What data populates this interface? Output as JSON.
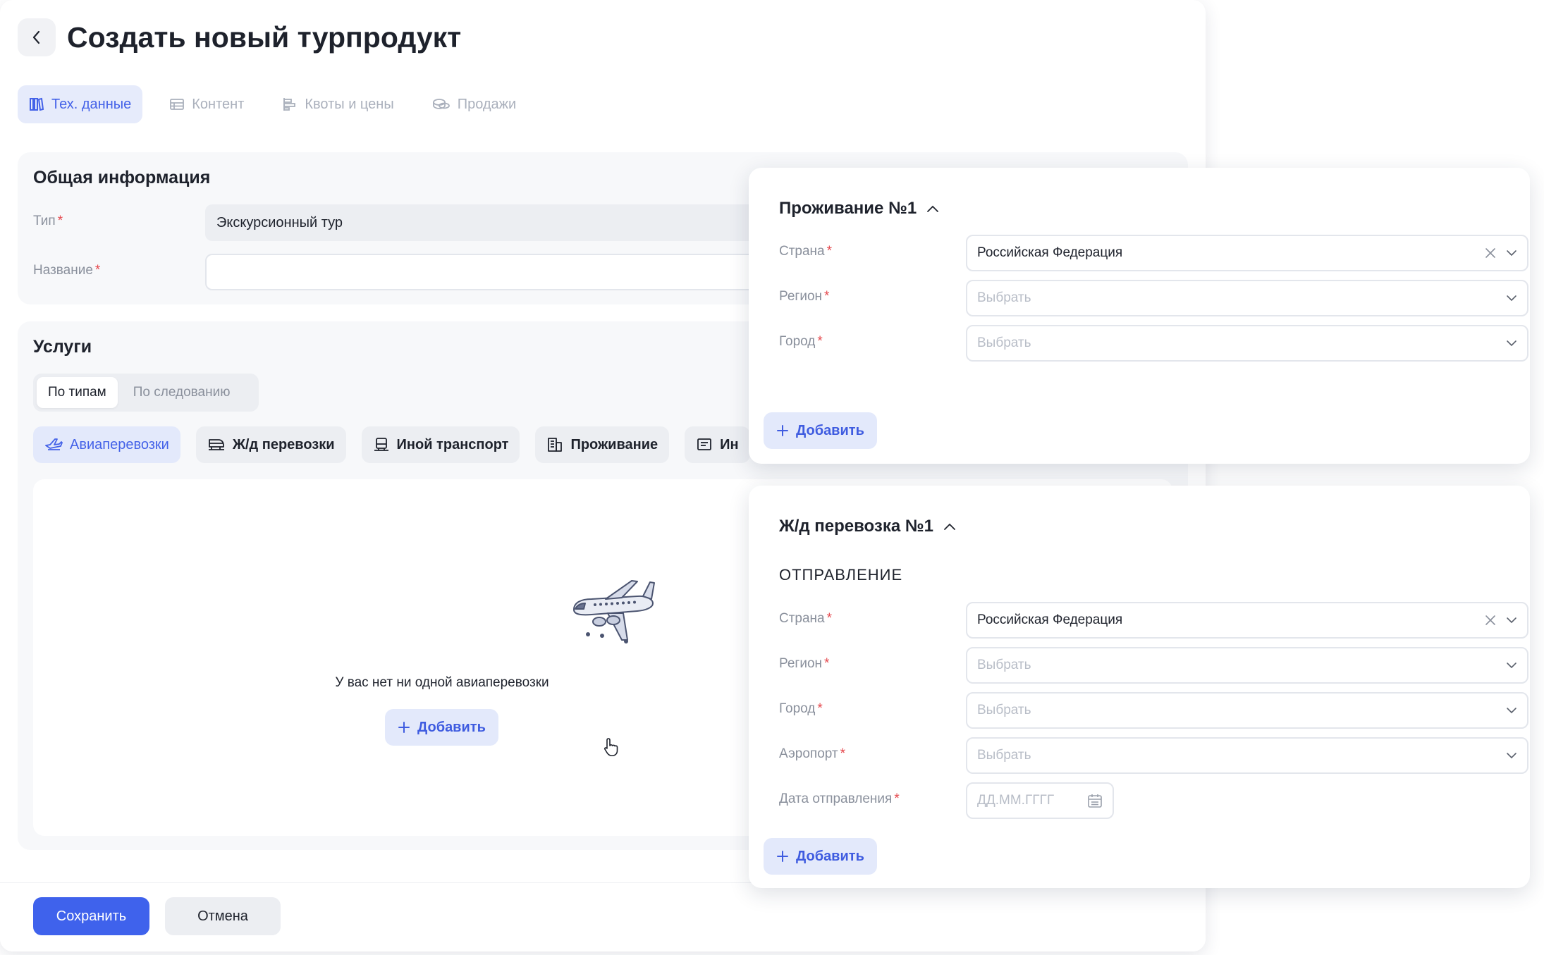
{
  "header": {
    "title": "Создать новый турпродукт"
  },
  "tabs": [
    {
      "label": "Тех. данные",
      "icon": "books-icon",
      "active": true
    },
    {
      "label": "Контент",
      "icon": "list-icon",
      "active": false
    },
    {
      "label": "Квоты и цены",
      "icon": "chart-bars-icon",
      "active": false
    },
    {
      "label": "Продажи",
      "icon": "coins-icon",
      "active": false
    }
  ],
  "general": {
    "title": "Общая информация",
    "type_label": "Тип",
    "type_value": "Экскурсионный тур",
    "name_label": "Название",
    "name_value": ""
  },
  "services": {
    "title": "Услуги",
    "segment": [
      "По типам",
      "По следованию"
    ],
    "chips": [
      {
        "label": "Авиаперевозки",
        "icon": "plane-icon",
        "active": true
      },
      {
        "label": "Ж/д перевозки",
        "icon": "train-icon",
        "active": false
      },
      {
        "label": "Иной транспорт",
        "icon": "bus-icon",
        "active": false
      },
      {
        "label": "Проживание",
        "icon": "building-icon",
        "active": false
      },
      {
        "label": "Ин",
        "icon": "document-icon",
        "active": false
      }
    ],
    "empty_text": "У вас нет ни одной авиаперевозки",
    "add_label": "Добавить"
  },
  "footer": {
    "save": "Сохранить",
    "cancel": "Отмена"
  },
  "accommodation": {
    "title": "Проживание №1",
    "country_label": "Страна",
    "country_value": "Российская Федерация",
    "region_label": "Регион",
    "region_placeholder": "Выбрать",
    "city_label": "Город",
    "city_placeholder": "Выбрать",
    "add_label": "Добавить"
  },
  "railway": {
    "title": "Ж/д перевозка №1",
    "subtitle": "ОТПРАВЛЕНИЕ",
    "country_label": "Страна",
    "country_value": "Российская Федерация",
    "region_label": "Регион",
    "region_placeholder": "Выбрать",
    "city_label": "Город",
    "city_placeholder": "Выбрать",
    "airport_label": "Аэропорт",
    "airport_placeholder": "Выбрать",
    "date_label": "Дата отправления",
    "date_placeholder": "ДД.ММ.ГГГГ",
    "add_label": "Добавить"
  },
  "colors": {
    "accent": "#3f62ec",
    "accent_soft": "#e3e9fb",
    "required": "#e5484d"
  }
}
